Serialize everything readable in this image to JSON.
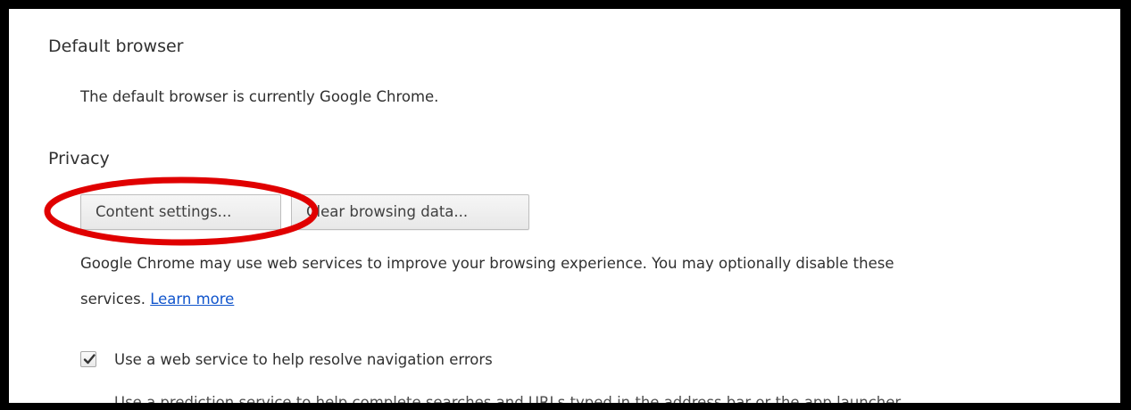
{
  "default_browser": {
    "title": "Default browser",
    "status": "The default browser is currently Google Chrome."
  },
  "privacy": {
    "title": "Privacy",
    "content_settings_label": "Content settings...",
    "clear_browsing_label": "Clear browsing data...",
    "description_line1": "Google Chrome may use web services to improve your browsing experience. You may optionally disable these",
    "description_line2": "services.",
    "learn_more": "Learn more",
    "nav_errors_label": "Use a web service to help resolve navigation errors",
    "nav_errors_checked": true,
    "next_line_partial": "Use a prediction service to help complete searches and URLs typed in the address bar or the app launcher"
  },
  "annotation": {
    "color": "#e00000",
    "shape": "ellipse"
  },
  "colors": {
    "frame": "#000000",
    "link": "#1155cc",
    "text": "#303030"
  }
}
